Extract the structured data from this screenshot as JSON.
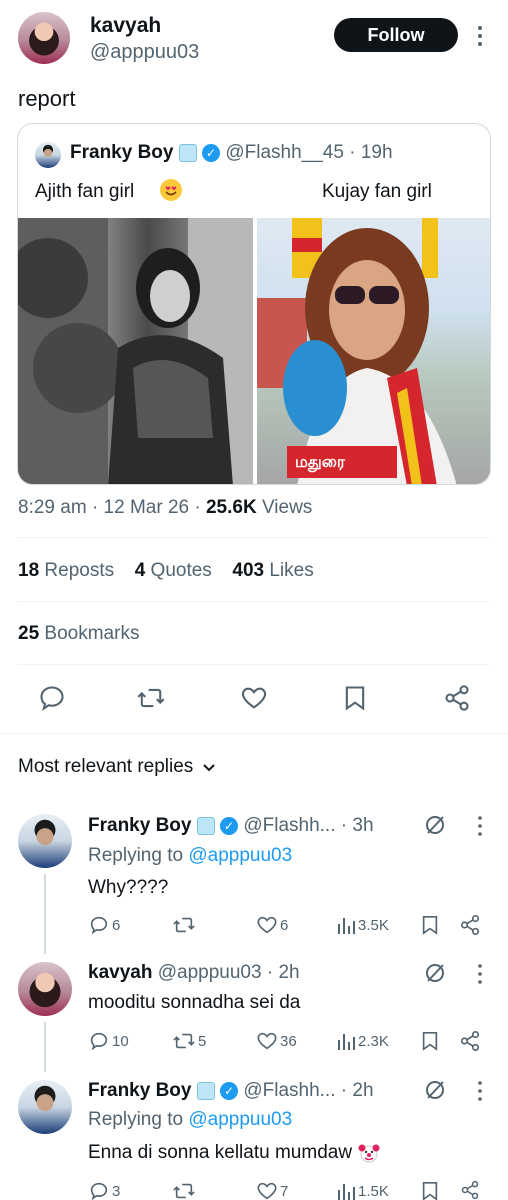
{
  "author": {
    "name": "kavyah",
    "handle": "@apppuu03",
    "follow_label": "Follow"
  },
  "tweet_text": "report",
  "quoted": {
    "name": "Franky Boy",
    "handle": "@Flashh__45",
    "time": "19h",
    "left_caption": "Ajith fan girl",
    "right_caption": "Kujay fan girl",
    "right_banner_text": "மதுரை"
  },
  "meta": {
    "time": "8:29 am",
    "date": "12 Mar 26",
    "views_count": "25.6K",
    "views_label": "Views"
  },
  "metrics": {
    "reposts_count": "18",
    "reposts_label": "Reposts",
    "quotes_count": "4",
    "quotes_label": "Quotes",
    "likes_count": "403",
    "likes_label": "Likes",
    "bookmarks_count": "25",
    "bookmarks_label": "Bookmarks"
  },
  "replies_header": "Most relevant replies",
  "replies": [
    {
      "name": "Franky Boy",
      "handle": "@Flashh...",
      "time": "3h",
      "replying_prefix": "Replying to",
      "replying_to": "@apppuu03",
      "text": "Why????",
      "replies": "6",
      "reposts": "",
      "likes": "6",
      "views": "3.5K"
    },
    {
      "name": "kavyah",
      "handle": "@apppuu03",
      "time": "2h",
      "text": "mooditu sonnadha sei da",
      "replies": "10",
      "reposts": "5",
      "likes": "36",
      "views": "2.3K"
    },
    {
      "name": "Franky Boy",
      "handle": "@Flashh...",
      "time": "2h",
      "replying_prefix": "Replying to",
      "replying_to": "@apppuu03",
      "text": "Enna di sonna kellatu mumdaw",
      "replies": "3",
      "reposts": "",
      "likes": "7",
      "views": "1.5K"
    }
  ],
  "colors": {
    "accent": "#1d9bf0",
    "text": "#0f1419",
    "muted": "#536471",
    "border": "#cfd9de"
  }
}
